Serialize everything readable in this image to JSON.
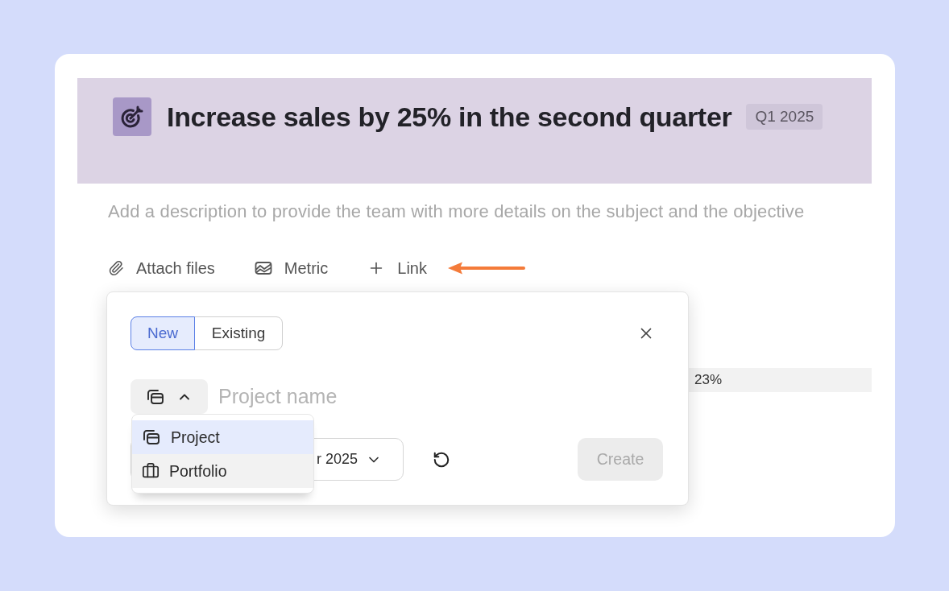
{
  "goal": {
    "title": "Increase sales by 25% in the second quarter",
    "period_badge": "Q1 2025",
    "description": {
      "placeholder": "Add a description to provide the team with more details on the subject and the objective"
    }
  },
  "toolbar": [
    {
      "kind": "attach",
      "label": "Attach files"
    },
    {
      "kind": "metric",
      "label": "Metric"
    },
    {
      "kind": "link",
      "label": "Link"
    }
  ],
  "row_behind_popup": {
    "value": "23%"
  },
  "link_popup": {
    "mode_tabs": [
      {
        "label": "New",
        "selected": true
      },
      {
        "label": "Existing",
        "selected": false
      }
    ],
    "type_button": {
      "expanded": true
    },
    "name_field": {
      "placeholder": "Project name"
    },
    "type_menu": [
      {
        "kind": "project",
        "label": "Project",
        "selected": true,
        "hovered": false
      },
      {
        "kind": "portfolio",
        "label": "Portfolio",
        "selected": false,
        "hovered": true
      }
    ],
    "period_select": {
      "value": "r 2025"
    },
    "create_button": {
      "label": "Create",
      "disabled": true
    }
  }
}
